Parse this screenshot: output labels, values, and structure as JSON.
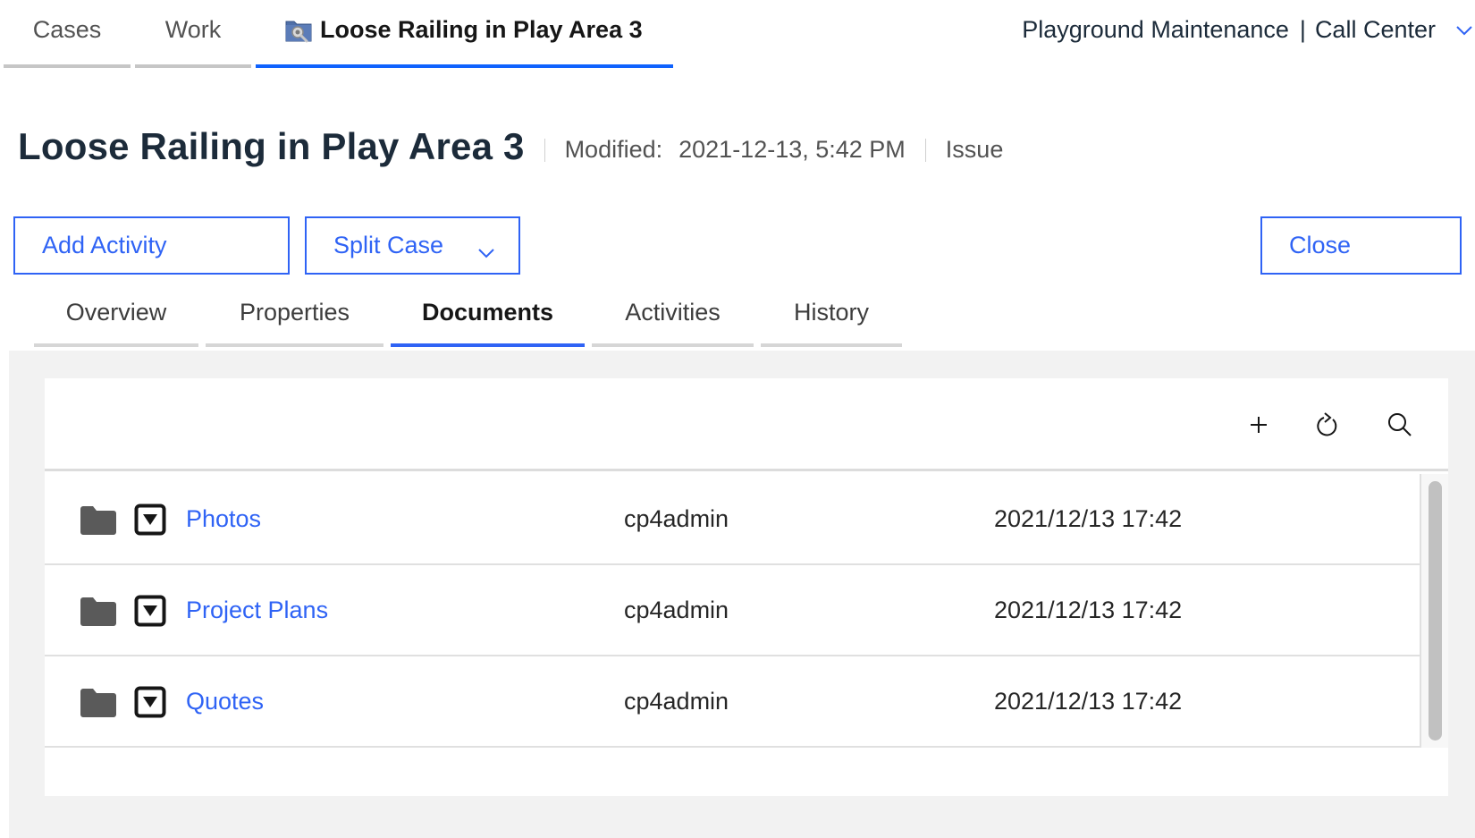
{
  "top_tabs": [
    {
      "label": "Cases",
      "active": false
    },
    {
      "label": "Work",
      "active": false
    },
    {
      "label": "Loose Railing in Play Area 3",
      "active": true,
      "icon": "case-folder-search-icon"
    }
  ],
  "context": {
    "solution": "Playground Maintenance",
    "separator": "|",
    "role": "Call Center",
    "icon": "chevron-down-icon"
  },
  "case": {
    "title": "Loose Railing in Play Area 3",
    "modified_label": "Modified:",
    "modified_value": "2021-12-13, 5:42 PM",
    "type": "Issue"
  },
  "buttons": {
    "add_activity": "Add Activity",
    "split_case": "Split Case",
    "close": "Close"
  },
  "sub_tabs": [
    {
      "label": "Overview",
      "active": false
    },
    {
      "label": "Properties",
      "active": false
    },
    {
      "label": "Documents",
      "active": true
    },
    {
      "label": "Activities",
      "active": false
    },
    {
      "label": "History",
      "active": false
    }
  ],
  "documents": {
    "toolbar_icons": [
      "add-icon",
      "refresh-icon",
      "search-icon"
    ],
    "rows": [
      {
        "name": "Photos",
        "owner": "cp4admin",
        "modified": "2021/12/13 17:42",
        "type": "folder"
      },
      {
        "name": "Project Plans",
        "owner": "cp4admin",
        "modified": "2021/12/13 17:42",
        "type": "folder"
      },
      {
        "name": "Quotes",
        "owner": "cp4admin",
        "modified": "2021/12/13 17:42",
        "type": "folder"
      }
    ]
  },
  "colors": {
    "accent": "#2f63f5",
    "title": "#1c2b3a",
    "folder": "#5a5a5a",
    "panel_bg": "#f2f2f2"
  }
}
